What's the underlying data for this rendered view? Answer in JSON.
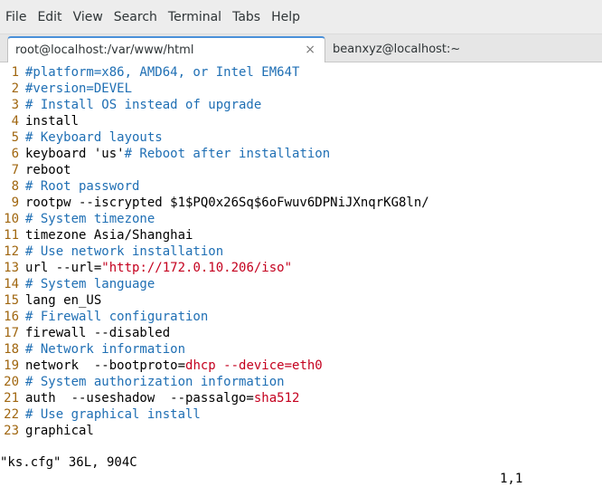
{
  "menubar": {
    "items": [
      "File",
      "Edit",
      "View",
      "Search",
      "Terminal",
      "Tabs",
      "Help"
    ]
  },
  "tabs": [
    {
      "label": "root@localhost:/var/www/html",
      "close": "×"
    },
    {
      "label": "beanxyz@localhost:~"
    }
  ],
  "editor": {
    "lines": [
      {
        "n": "1",
        "segments": [
          {
            "t": "#platform=x86, AMD64, or Intel EM64T",
            "c": "cmt"
          }
        ]
      },
      {
        "n": "2",
        "segments": [
          {
            "t": "#version=DEVEL",
            "c": "cmt"
          }
        ]
      },
      {
        "n": "3",
        "segments": [
          {
            "t": "# Install OS instead of upgrade",
            "c": "cmt"
          }
        ]
      },
      {
        "n": "4",
        "segments": [
          {
            "t": "install",
            "c": "code"
          }
        ]
      },
      {
        "n": "5",
        "segments": [
          {
            "t": "# Keyboard layouts",
            "c": "cmt"
          }
        ]
      },
      {
        "n": "6",
        "segments": [
          {
            "t": "keyboard 'us'",
            "c": "code"
          },
          {
            "t": "# Reboot after installation",
            "c": "cmt"
          }
        ]
      },
      {
        "n": "7",
        "segments": [
          {
            "t": "reboot",
            "c": "code"
          }
        ]
      },
      {
        "n": "8",
        "segments": [
          {
            "t": "# Root password",
            "c": "cmt"
          }
        ]
      },
      {
        "n": "9",
        "segments": [
          {
            "t": "rootpw --iscrypted $1$PQ0x26Sq$6oFwuv6DPNiJXnqrKG8ln/",
            "c": "code"
          }
        ]
      },
      {
        "n": "10",
        "segments": [
          {
            "t": "# System timezone",
            "c": "cmt"
          }
        ]
      },
      {
        "n": "11",
        "segments": [
          {
            "t": "timezone Asia/Shanghai",
            "c": "code"
          }
        ]
      },
      {
        "n": "12",
        "segments": [
          {
            "t": "# Use network installation",
            "c": "cmt"
          }
        ]
      },
      {
        "n": "13",
        "segments": [
          {
            "t": "url --url=",
            "c": "code"
          },
          {
            "t": "\"http://172.0.10.206/iso\"",
            "c": "str"
          }
        ]
      },
      {
        "n": "14",
        "segments": [
          {
            "t": "# System language",
            "c": "cmt"
          }
        ]
      },
      {
        "n": "15",
        "segments": [
          {
            "t": "lang en_US",
            "c": "code"
          }
        ]
      },
      {
        "n": "16",
        "segments": [
          {
            "t": "# Firewall configuration",
            "c": "cmt"
          }
        ]
      },
      {
        "n": "17",
        "segments": [
          {
            "t": "firewall --disabled",
            "c": "code"
          }
        ]
      },
      {
        "n": "18",
        "segments": [
          {
            "t": "# Network information",
            "c": "cmt"
          }
        ]
      },
      {
        "n": "19",
        "segments": [
          {
            "t": "network  --bootproto=",
            "c": "code"
          },
          {
            "t": "dhcp",
            "c": "str"
          },
          {
            "t": " --device=eth0",
            "c": "opt"
          }
        ]
      },
      {
        "n": "20",
        "segments": [
          {
            "t": "# System authorization information",
            "c": "cmt"
          }
        ]
      },
      {
        "n": "21",
        "segments": [
          {
            "t": "auth  --useshadow  --passalgo=",
            "c": "code"
          },
          {
            "t": "sha512",
            "c": "str"
          }
        ]
      },
      {
        "n": "22",
        "segments": [
          {
            "t": "# Use graphical install",
            "c": "cmt"
          }
        ]
      },
      {
        "n": "23",
        "segments": [
          {
            "t": "graphical",
            "c": "code"
          }
        ]
      }
    ]
  },
  "status": {
    "left": "\"ks.cfg\" 36L, 904C",
    "right": "1,1"
  }
}
